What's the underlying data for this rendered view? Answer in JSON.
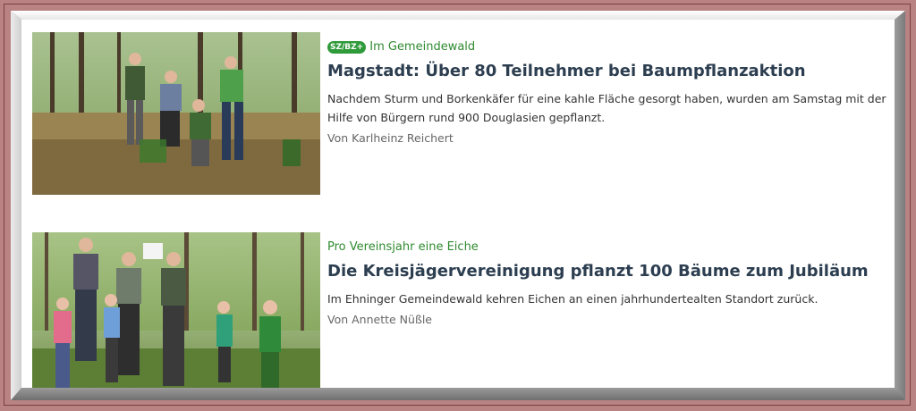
{
  "articles": [
    {
      "kicker": "Im Gemeindewald",
      "badge": "SZ/BZ+",
      "headline": "Magstadt: Über 80 Teilnehmer bei Baumpflanzaktion",
      "teaser": "Nachdem Sturm und Borkenkäfer für eine kahle Fläche gesorgt haben, wurden am Samstag mit der Hilfe von Bürgern rund 900 Douglasien gepflanzt.",
      "author": "Von Karlheinz Reichert",
      "image_icon": "photo-tree-planting-group"
    },
    {
      "kicker": "Pro Vereinsjahr eine Eiche",
      "headline": "Die Kreisjägervereinigung pflanzt 100 Bäume zum Jubiläum",
      "teaser": "Im Ehninger Gemeindewald kehren Eichen an einen jahrhundertealten Standort zurück.",
      "author": "Von Annette Nüßle",
      "image_icon": "photo-hunters-with-children"
    }
  ],
  "colors": {
    "kicker": "#2f8a2f",
    "headline": "#2c3e50",
    "frame_bg": "#b98384"
  }
}
